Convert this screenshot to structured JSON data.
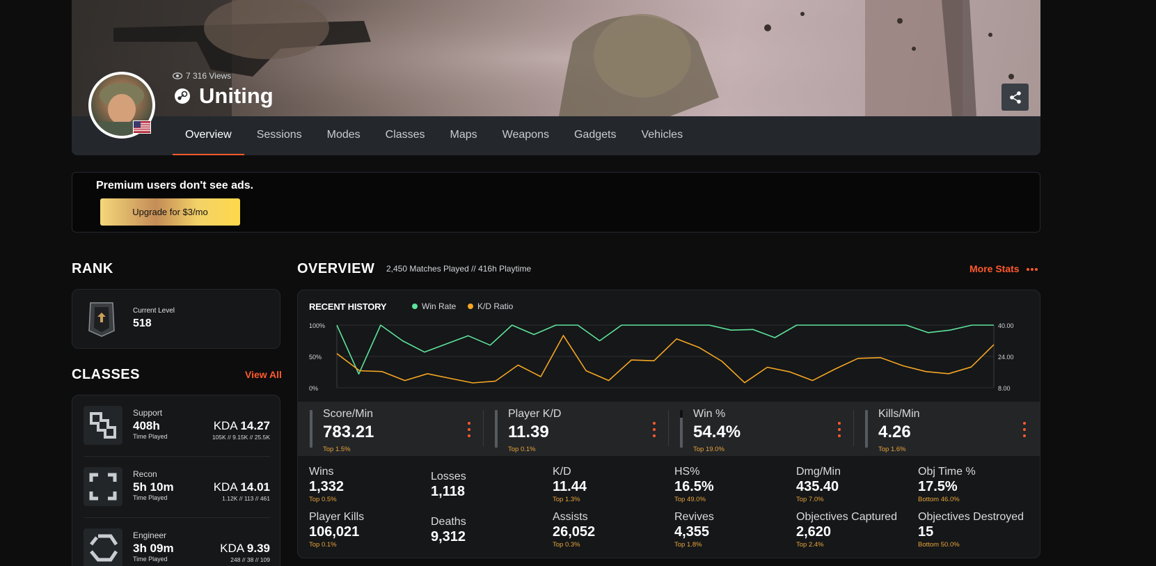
{
  "profile": {
    "views": "7 316 Views",
    "name": "Uniting"
  },
  "tabs": [
    "Overview",
    "Sessions",
    "Modes",
    "Classes",
    "Maps",
    "Weapons",
    "Gadgets",
    "Vehicles"
  ],
  "promo": {
    "text": "Premium users don't see ads.",
    "button": "Upgrade for $3/mo"
  },
  "rank": {
    "title": "RANK",
    "label": "Current Level",
    "level": "518"
  },
  "classes": {
    "title": "CLASSES",
    "view_all": "View All",
    "items": [
      {
        "name": "Support",
        "time": "408h",
        "time_label": "Time Played",
        "kda_label": "KDA",
        "kda": "14.27",
        "sub": "105K // 9.15K // 25.5K"
      },
      {
        "name": "Recon",
        "time": "5h 10m",
        "time_label": "Time Played",
        "kda_label": "KDA",
        "kda": "14.01",
        "sub": "1.12K // 113 // 461"
      },
      {
        "name": "Engineer",
        "time": "3h 09m",
        "time_label": "Time Played",
        "kda_label": "KDA",
        "kda": "9.39",
        "sub": "248 // 38 // 109"
      }
    ]
  },
  "overview": {
    "title": "OVERVIEW",
    "matches": "2,450 Matches Played // 416h Playtime",
    "more_stats": "More Stats"
  },
  "chart_data": {
    "type": "line",
    "title": "RECENT HISTORY",
    "series": [
      {
        "name": "Win Rate",
        "axis": "left",
        "color": "#5ee39a",
        "values": [
          100,
          22,
          100,
          75,
          57,
          70,
          83,
          68,
          100,
          85,
          100,
          100,
          75,
          100,
          100,
          100,
          100,
          100,
          92,
          93,
          80,
          100,
          100,
          100,
          100,
          100,
          100,
          88,
          92,
          100,
          100
        ]
      },
      {
        "name": "K/D Ratio",
        "axis": "right",
        "color": "#f5a623",
        "values": [
          25.5,
          16.7,
          16.3,
          11.7,
          15.2,
          12.8,
          10.5,
          11.4,
          19.6,
          13.7,
          34.7,
          16.7,
          11.7,
          22.2,
          21.8,
          33,
          28.5,
          21.5,
          10.6,
          18.5,
          16.1,
          11.7,
          17.6,
          23,
          23.4,
          19.2,
          16.3,
          15.2,
          18.6,
          30
        ]
      }
    ],
    "left_ticks": [
      "100%",
      "50%",
      "0%"
    ],
    "right_ticks": [
      "40.00",
      "24.00",
      "8.00"
    ],
    "left_range": [
      0,
      100
    ],
    "right_range": [
      8,
      40
    ],
    "legend": "top"
  },
  "kpis": [
    {
      "label": "Score/Min",
      "value": "783.21",
      "rank": "Top 1.5%",
      "fill": 0
    },
    {
      "label": "Player K/D",
      "value": "11.39",
      "rank": "Top 0.1%",
      "fill": 0
    },
    {
      "label": "Win %",
      "value": "54.4%",
      "rank": "Top 19.0%",
      "fill": 0.2
    },
    {
      "label": "Kills/Min",
      "value": "4.26",
      "rank": "Top 1.6%",
      "fill": 0
    }
  ],
  "stats": [
    {
      "label": "Wins",
      "value": "1,332",
      "rank": "Top 0.5%"
    },
    {
      "label": "Losses",
      "value": "1,118",
      "rank": ""
    },
    {
      "label": "K/D",
      "value": "11.44",
      "rank": "Top 1.3%"
    },
    {
      "label": "HS%",
      "value": "16.5%",
      "rank": "Top 49.0%"
    },
    {
      "label": "Dmg/Min",
      "value": "435.40",
      "rank": "Top 7.0%"
    },
    {
      "label": "Obj Time %",
      "value": "17.5%",
      "rank": "Bottom 46.0%"
    },
    {
      "label": "Player Kills",
      "value": "106,021",
      "rank": "Top 0.1%"
    },
    {
      "label": "Deaths",
      "value": "9,312",
      "rank": ""
    },
    {
      "label": "Assists",
      "value": "26,052",
      "rank": "Top 0.3%"
    },
    {
      "label": "Revives",
      "value": "4,355",
      "rank": "Top 1.8%"
    },
    {
      "label": "Objectives Captured",
      "value": "2,620",
      "rank": "Top 2.4%"
    },
    {
      "label": "Objectives Destroyed",
      "value": "15",
      "rank": "Bottom 50.0%"
    }
  ]
}
